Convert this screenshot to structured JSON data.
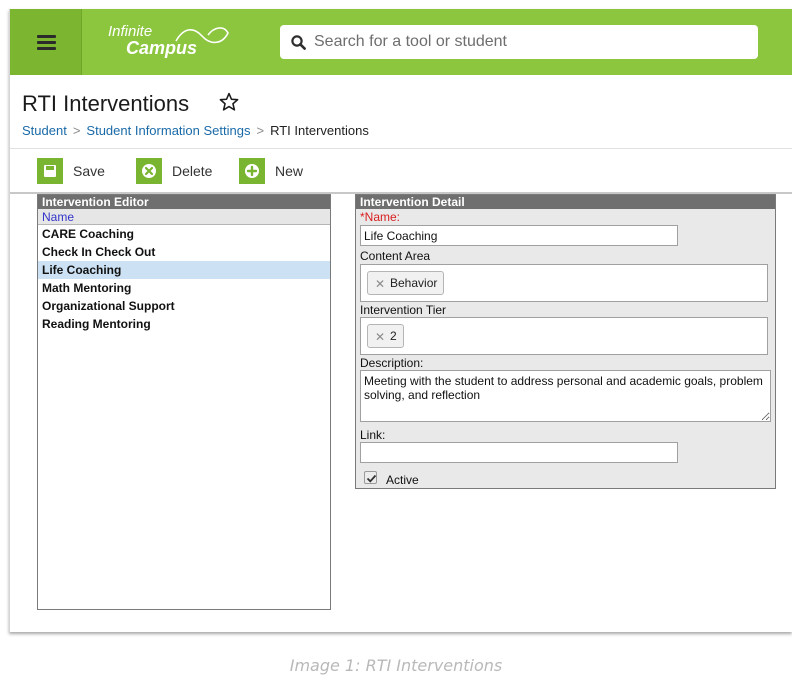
{
  "header": {
    "logo_line1": "Infinite",
    "logo_line2": "Campus",
    "search_placeholder": "Search for a tool or student",
    "menu_icon": "hamburger-icon",
    "search_icon": "magnifier-icon",
    "brand_color": "#8cc63f"
  },
  "page": {
    "title": "RTI Interventions",
    "favorite_icon": "star-outline-icon",
    "breadcrumb": [
      "Student",
      "Student Information Settings",
      "RTI Interventions"
    ]
  },
  "toolbar": {
    "save_label": "Save",
    "delete_label": "Delete",
    "new_label": "New",
    "icon_color": "#79b530"
  },
  "editor": {
    "title": "Intervention Editor",
    "column_header": "Name",
    "items": [
      "CARE Coaching",
      "Check In Check Out",
      "Life Coaching",
      "Math Mentoring",
      "Organizational Support",
      "Reading Mentoring"
    ],
    "selected": "Life Coaching"
  },
  "detail": {
    "title": "Intervention Detail",
    "name_required_mark": "*",
    "name_label": "Name:",
    "name_value": "Life Coaching",
    "content_area_label": "Content Area",
    "content_area_tag": "Behavior",
    "tier_label": "Intervention Tier",
    "tier_tag": "2",
    "description_label": "Description:",
    "description_value": "Meeting with the student to address personal and academic goals, problem solving, and reflection",
    "link_label": "Link:",
    "link_value": "",
    "active_label": "Active",
    "active_checked": true
  },
  "caption": "Image 1: RTI Interventions"
}
